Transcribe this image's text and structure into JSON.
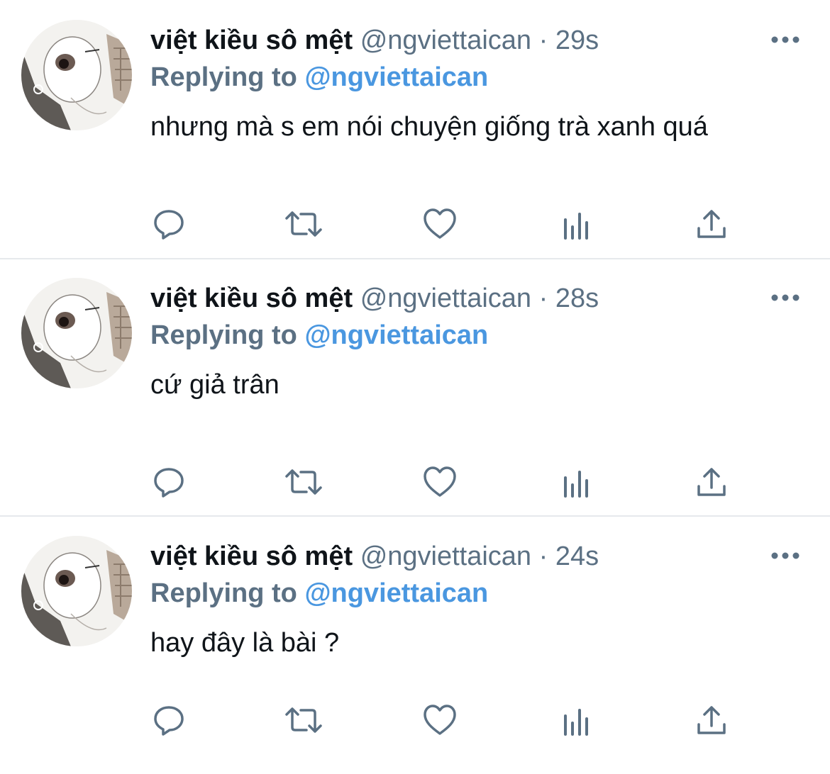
{
  "tweets": [
    {
      "display_name": "việt kiều sô mệt",
      "handle": "@ngviettaican",
      "separator": "·",
      "time": "29s",
      "replying_label": "Replying to",
      "replying_handle": "@ngviettaican",
      "text": "nhưng mà s em nói chuyện giống trà xanh quá"
    },
    {
      "display_name": "việt kiều sô mệt",
      "handle": "@ngviettaican",
      "separator": "·",
      "time": "28s",
      "replying_label": "Replying to",
      "replying_handle": "@ngviettaican",
      "text": "cứ giả trân"
    },
    {
      "display_name": "việt kiều sô mệt",
      "handle": "@ngviettaican",
      "separator": "·",
      "time": "24s",
      "replying_label": "Replying to",
      "replying_handle": "@ngviettaican",
      "text": "hay đây là bài ?"
    }
  ],
  "icons": {
    "more": "more-horizontal-icon",
    "reply": "reply-icon",
    "retweet": "retweet-icon",
    "like": "heart-icon",
    "analytics": "analytics-icon",
    "share": "share-icon",
    "avatar": "avatar"
  },
  "colors": {
    "text_primary": "#0f1419",
    "text_secondary": "#5b7083",
    "link": "#4a97e0",
    "icon": "#5b7083",
    "divider": "#e6e9ec"
  }
}
